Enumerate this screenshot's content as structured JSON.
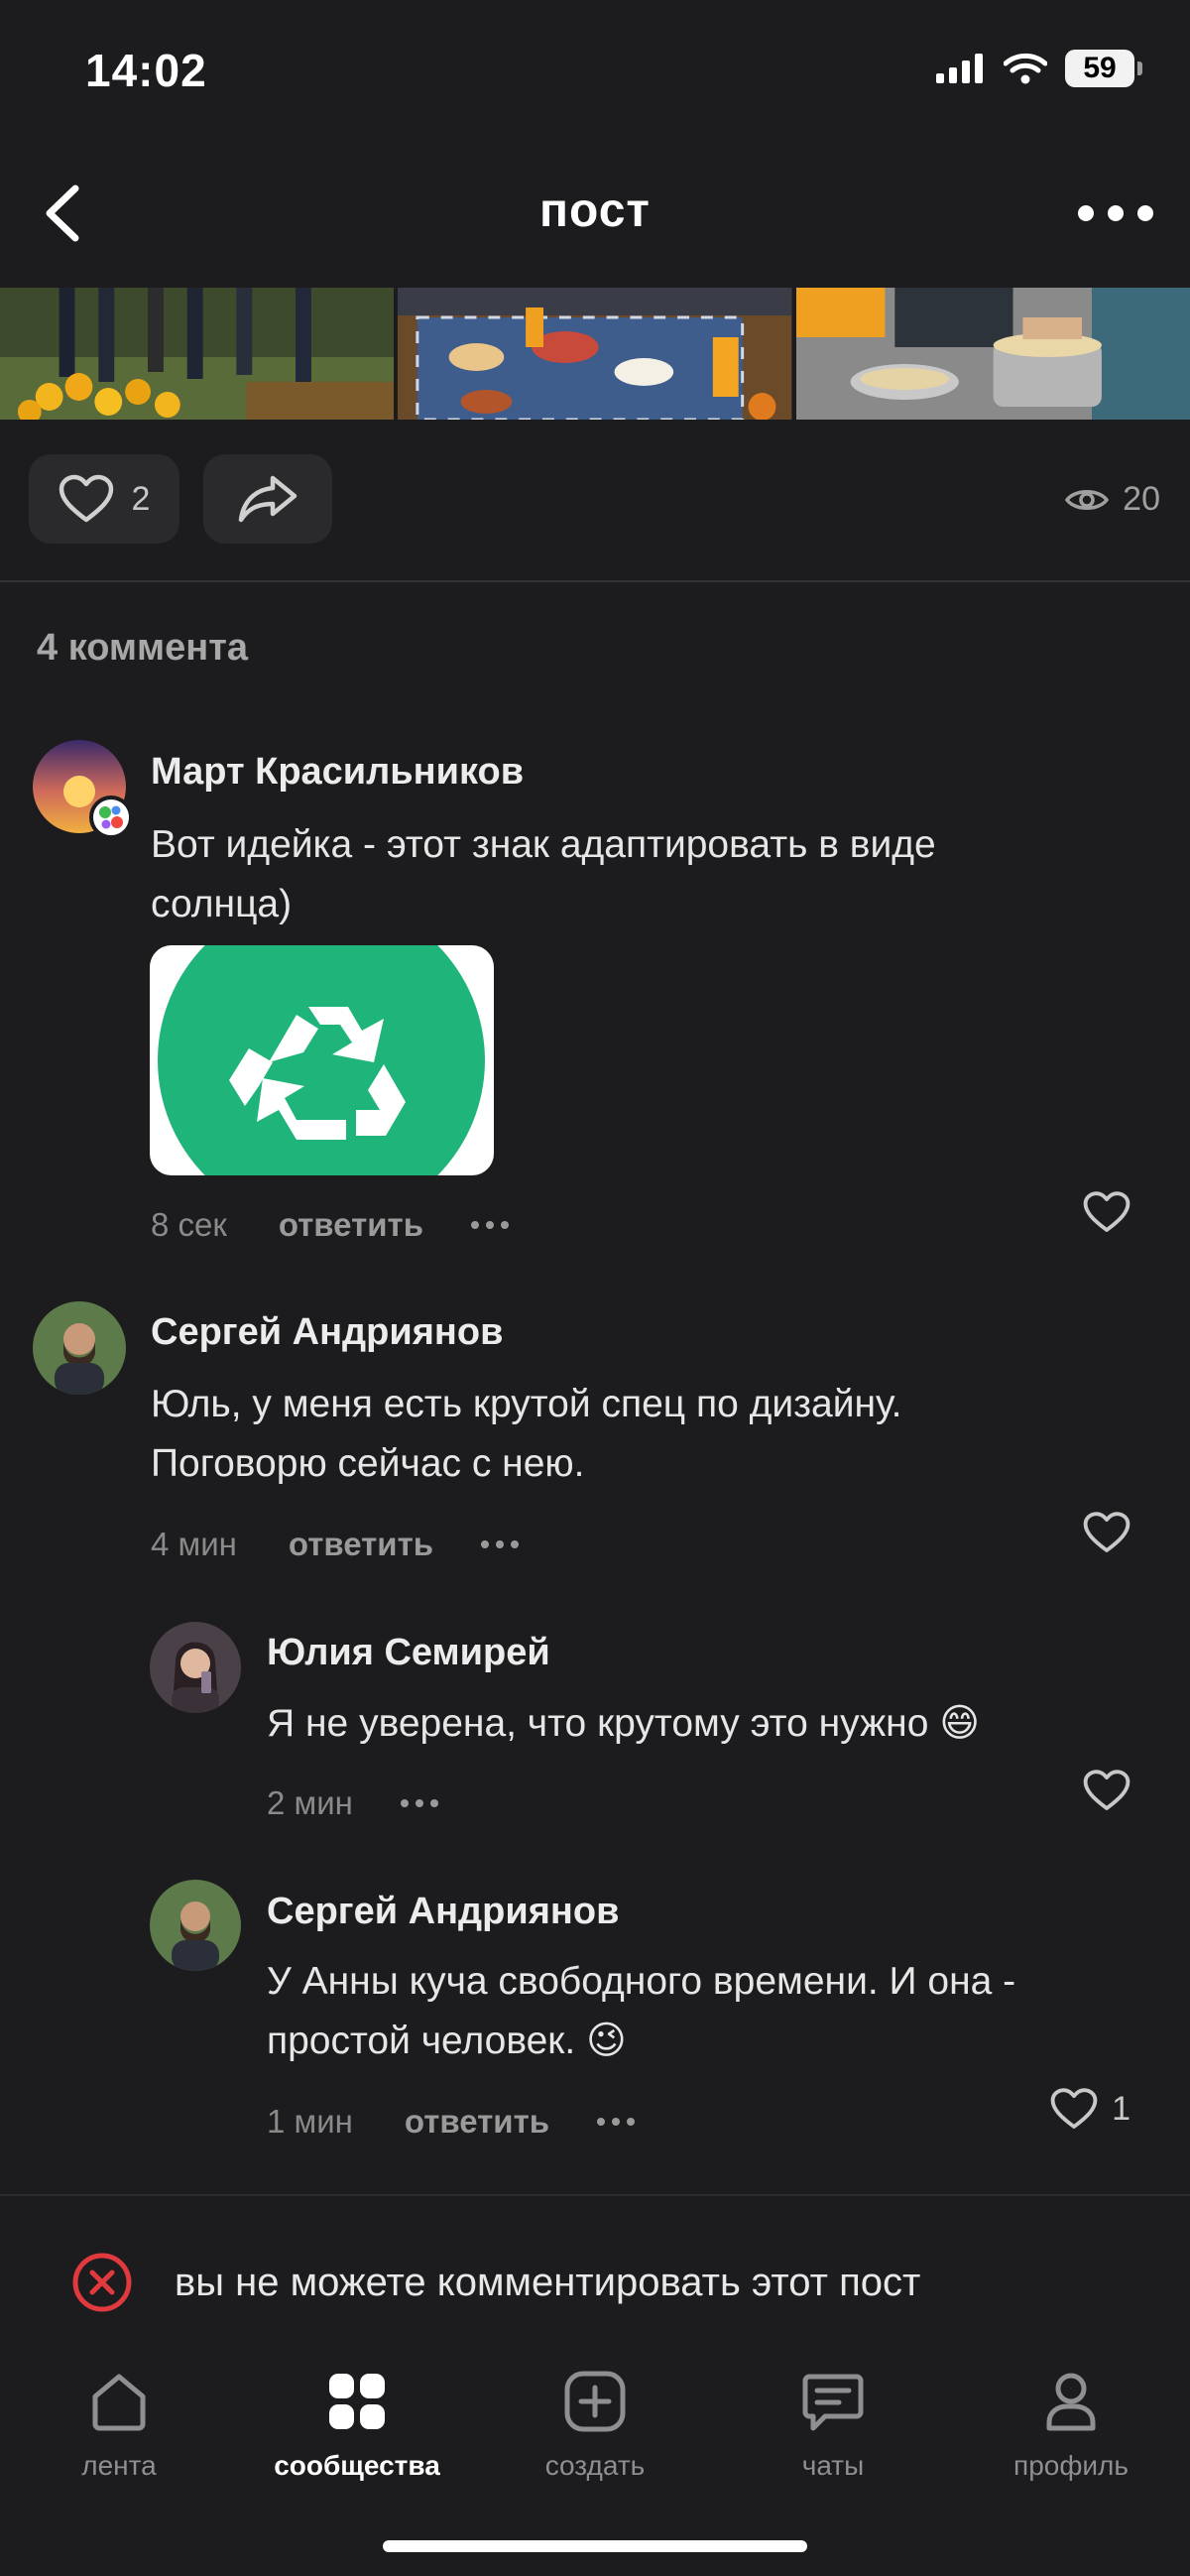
{
  "status_bar": {
    "time": "14:02",
    "battery": "59"
  },
  "header": {
    "title": "пост"
  },
  "post": {
    "likes": "2",
    "views": "20"
  },
  "comments_count_label": "4 коммента",
  "comments": [
    {
      "author": "Март Красильников",
      "text": "Вот идейка - этот знак адаптировать в виде солнца)",
      "time": "8 сек",
      "reply_label": "ответить",
      "likes": ""
    },
    {
      "author": "Сергей Андриянов",
      "text": "Юль, у меня есть крутой спец по дизайну. Поговорю сейчас с нею.",
      "time": "4 мин",
      "reply_label": "ответить",
      "likes": ""
    },
    {
      "author": "Юлия Семирей",
      "text": "Я не уверена, что крутому это нужно",
      "emoji": "😄",
      "time": "2 мин",
      "likes": ""
    },
    {
      "author": "Сергей Андриянов",
      "text": "У Анны куча свободного времени. И она - простой человек.",
      "emoji": "😉",
      "time": "1 мин",
      "reply_label": "ответить",
      "likes": "1"
    }
  ],
  "notice": "вы не можете комментировать этот пост",
  "tabs": [
    {
      "label": "лента",
      "icon": "home-icon",
      "active": false
    },
    {
      "label": "сообщества",
      "icon": "grid-icon",
      "active": true
    },
    {
      "label": "создать",
      "icon": "plus-square-icon",
      "active": false
    },
    {
      "label": "чаты",
      "icon": "chat-icon",
      "active": false
    },
    {
      "label": "профиль",
      "icon": "person-icon",
      "active": false
    }
  ],
  "colors": {
    "background": "#1c1c1e",
    "recycle_green": "#1fb47a",
    "error_red": "#e0393e"
  }
}
